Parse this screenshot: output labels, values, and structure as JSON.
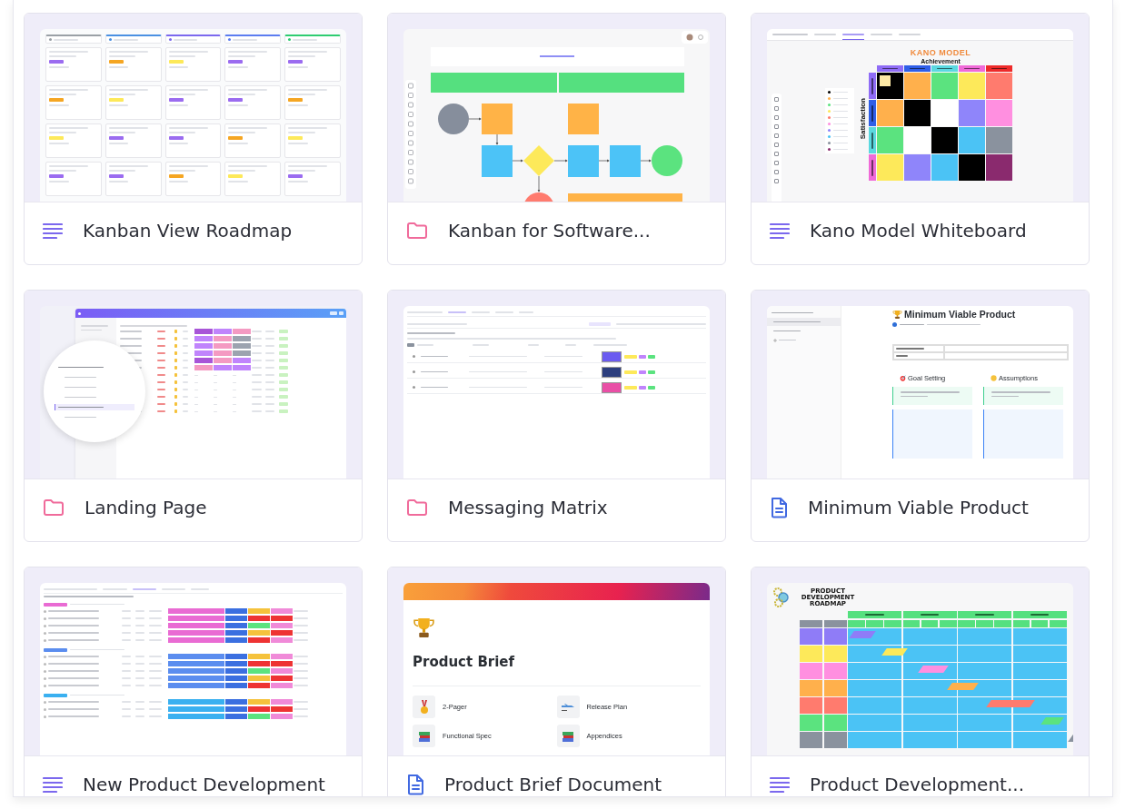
{
  "cards": [
    {
      "title": "Kanban View Roadmap",
      "kind": "list",
      "preview": {
        "kind": "kanban",
        "columns": [
          {
            "color": "#9aa0a6"
          },
          {
            "color": "#4a90e2"
          },
          {
            "color": "#7b68ee"
          },
          {
            "color": "#5b7cf0"
          },
          {
            "color": "#2ecc71"
          }
        ]
      }
    },
    {
      "title": "Kanban for Software...",
      "kind": "folder",
      "preview": {
        "kind": "flow",
        "nodes": [
          {
            "kind": "circle",
            "color": "#868e9c"
          },
          {
            "kind": "box",
            "color": "#ffb347"
          },
          {
            "kind": "box",
            "color": "#ffb347"
          },
          {
            "kind": "box",
            "color": "#4cc3f7"
          },
          {
            "kind": "diamond",
            "color": "#fde95a"
          },
          {
            "kind": "box",
            "color": "#4cc3f7"
          },
          {
            "kind": "box",
            "color": "#4cc3f7"
          },
          {
            "kind": "circle",
            "color": "#5be37f"
          },
          {
            "kind": "circle",
            "color": "#ff7b6e"
          },
          {
            "kind": "bar",
            "color": "#ffb347"
          }
        ]
      }
    },
    {
      "title": "Kano Model Whiteboard",
      "kind": "list",
      "preview": {
        "kind": "kano",
        "tabs": [
          {
            "selected": false
          },
          {
            "selected": true
          },
          {
            "selected": false
          },
          {
            "selected": false
          }
        ],
        "title": "KANO MODEL",
        "x_axis": "Achievement",
        "y_axis": "Satisfaction",
        "columns": [
          {
            "color": "#8f6cf6"
          },
          {
            "color": "#2f5ee8"
          },
          {
            "color": "#5ad8e0"
          },
          {
            "color": "#f06ad8"
          },
          {
            "color": "#ee2a2a"
          }
        ],
        "rows": [
          {
            "color": "#8f6cf6",
            "cells": [
              {
                "color": "#000000"
              },
              {
                "color": "#ffb04c"
              },
              {
                "color": "#5be37f"
              },
              {
                "color": "#fde95a"
              },
              {
                "color": "#ff7b6e"
              }
            ]
          },
          {
            "color": "#2f5ee8",
            "cells": [
              {
                "color": "#ffb04c"
              },
              {
                "color": "#000000"
              },
              {
                "color": "#ffffff"
              },
              {
                "color": "#8f85fa"
              },
              {
                "color": "#ff8fe0"
              }
            ]
          },
          {
            "color": "#5ad8e0",
            "cells": [
              {
                "color": "#5be37f"
              },
              {
                "color": "#ffffff"
              },
              {
                "color": "#000000"
              },
              {
                "color": "#4bc3f5"
              },
              {
                "color": "#8a929e"
              }
            ]
          },
          {
            "color": "#f06ad8",
            "cells": [
              {
                "color": "#fde95a"
              },
              {
                "color": "#8f85fa"
              },
              {
                "color": "#4bc3f5"
              },
              {
                "color": "#000000"
              },
              {
                "color": "#8a2a6e"
              }
            ]
          }
        ]
      }
    },
    {
      "title": "Landing Page",
      "kind": "folder",
      "preview": {
        "kind": "landing",
        "tree": [
          {
            "selected": false
          },
          {
            "selected": false
          },
          {
            "selected": false
          },
          {
            "selected": false
          },
          {
            "selected": true
          },
          {
            "selected": false
          }
        ]
      }
    },
    {
      "title": "Messaging Matrix",
      "kind": "folder",
      "preview": {
        "kind": "matrix",
        "rows": [
          {
            "color": "#6b5bf0"
          },
          {
            "color": "#2c3e7e"
          },
          {
            "color": "#e94fa6"
          }
        ]
      }
    },
    {
      "title": "Minimum Viable Product",
      "kind": "doc",
      "preview": {
        "kind": "mvp",
        "pages": [
          {
            "selected": true
          },
          {
            "selected": false
          }
        ],
        "title": "Minimum Viable Product",
        "sections": [
          {
            "heading": "Goal Setting",
            "kind": "dart"
          },
          {
            "heading": "Assumptions",
            "kind": "thinking"
          }
        ]
      }
    },
    {
      "title": "New Product Development",
      "kind": "list",
      "preview": {
        "kind": "table",
        "groups": [
          {
            "color": "#e96bd3"
          },
          {
            "color": "#5b8def"
          },
          {
            "color": "#3ab0f0"
          }
        ]
      }
    },
    {
      "title": "Product Brief Document",
      "kind": "doc",
      "preview": {
        "kind": "brief",
        "title": "Product Brief",
        "links": [
          {
            "label": "2-Pager",
            "kind": "medal"
          },
          {
            "label": "Release Plan",
            "kind": "plane"
          },
          {
            "label": "Functional Spec",
            "kind": "books"
          },
          {
            "label": "Appendices",
            "kind": "books"
          }
        ]
      }
    },
    {
      "title": "Product Development...",
      "kind": "list",
      "preview": {
        "kind": "roadmap",
        "title": "PRODUCT DEVELOPMENT ROADMAP",
        "rows": [
          {
            "color": "#8f7cf7"
          },
          {
            "color": "#fde95a"
          },
          {
            "color": "#ff8fe0"
          },
          {
            "color": "#ffb04c"
          },
          {
            "color": "#ff7b6e"
          },
          {
            "color": "#5be37f"
          },
          {
            "color": "#8a929e"
          }
        ]
      }
    }
  ]
}
